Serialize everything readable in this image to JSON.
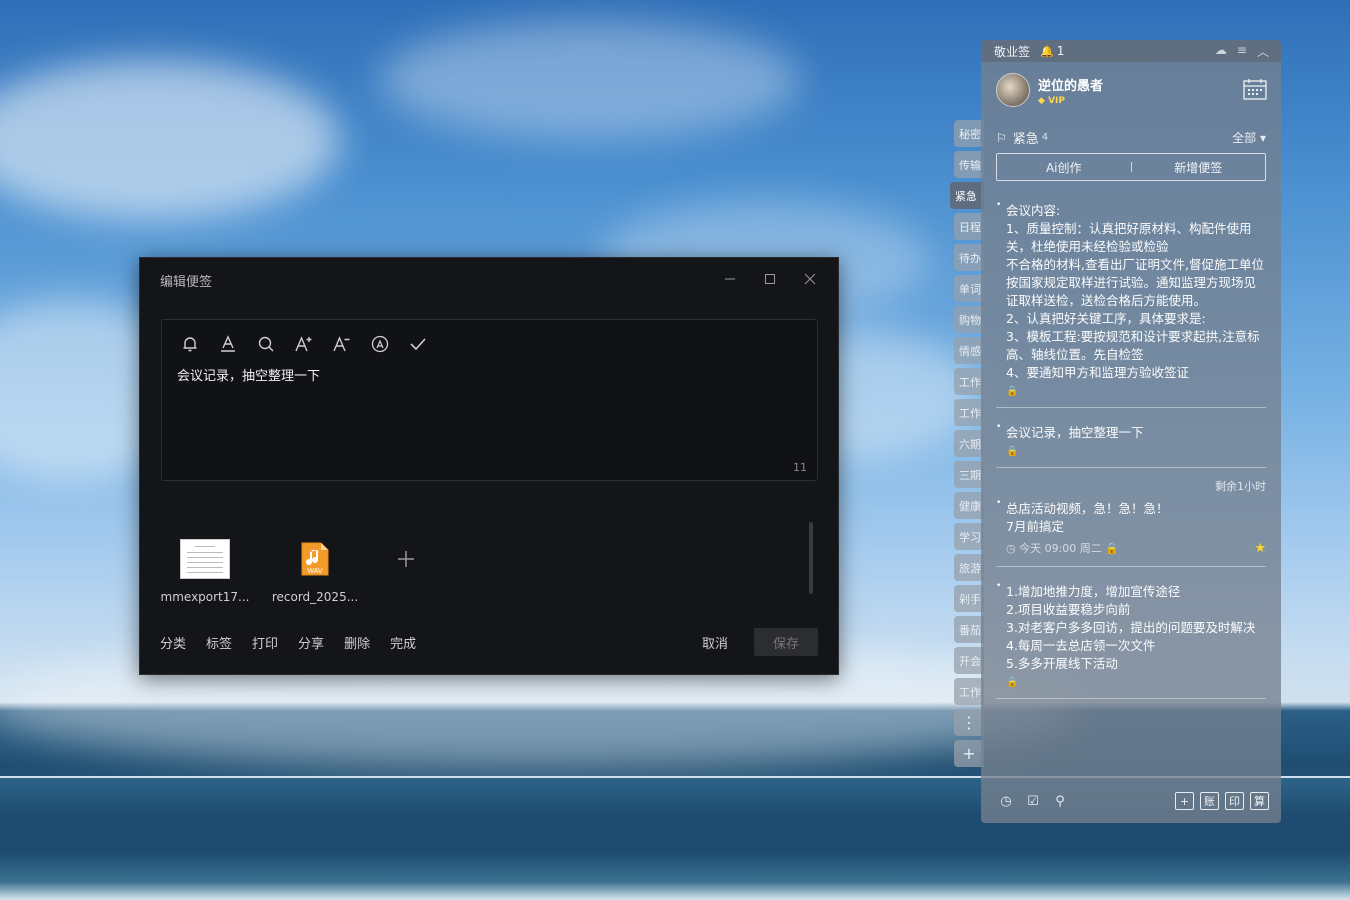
{
  "editor": {
    "title": "编辑便签",
    "content": "会议记录，抽空整理一下",
    "char_count": "11",
    "attachments": [
      {
        "name": "mmexport17..."
      },
      {
        "name": "record_2025..."
      }
    ],
    "wav_label": "WAV",
    "actions": [
      "分类",
      "标签",
      "打印",
      "分享",
      "删除",
      "完成"
    ],
    "cancel": "取消",
    "save": "保存"
  },
  "sidetabs": [
    "秘密",
    "传输",
    "紧急",
    "日程",
    "待办",
    "单词",
    "购物",
    "情感",
    "工作",
    "工作",
    "六期",
    "三期",
    "健康",
    "学习",
    "旅游",
    "剁手",
    "番茄",
    "开会",
    "工作"
  ],
  "widget": {
    "app_name": "敬业签",
    "notif_count": "1",
    "user_name": "逆位的愚者",
    "vip": "VIP",
    "category": "紧急",
    "category_count": "4",
    "filter": "全部",
    "btn_ai": "Ai创作",
    "btn_new": "新增便签",
    "notes": [
      {
        "text": "会议内容:\n1、质量控制：认真把好原材料、构配件使用关，杜绝使用未经检验或检验\n不合格的材料,查看出厂证明文件,督促施工单位按国家规定取样进行试验。通知监理方现场见证取样送检，送检合格后方能使用。\n2、认真把好关键工序，具体要求是:\n3、模板工程:要按规范和设计要求起拱,注意标高、轴线位置。先自检签\n4、要通知甲方和监理方验收签证"
      },
      {
        "text": "会议记录，抽空整理一下"
      },
      {
        "remain": "剩余1小时",
        "text": "总店活动视频，急！急！急！\n7月前搞定",
        "time": "今天 09:00 周二"
      },
      {
        "text": "1.增加地推力度，增加宣传途径\n2.项目收益要稳步向前\n3.对老客户多多回访，提出的问题要及时解决\n4.每周一去总店领一次文件\n5.多多开展线下活动"
      }
    ],
    "bottom_boxes": [
      "+",
      "账",
      "印",
      "算"
    ]
  }
}
